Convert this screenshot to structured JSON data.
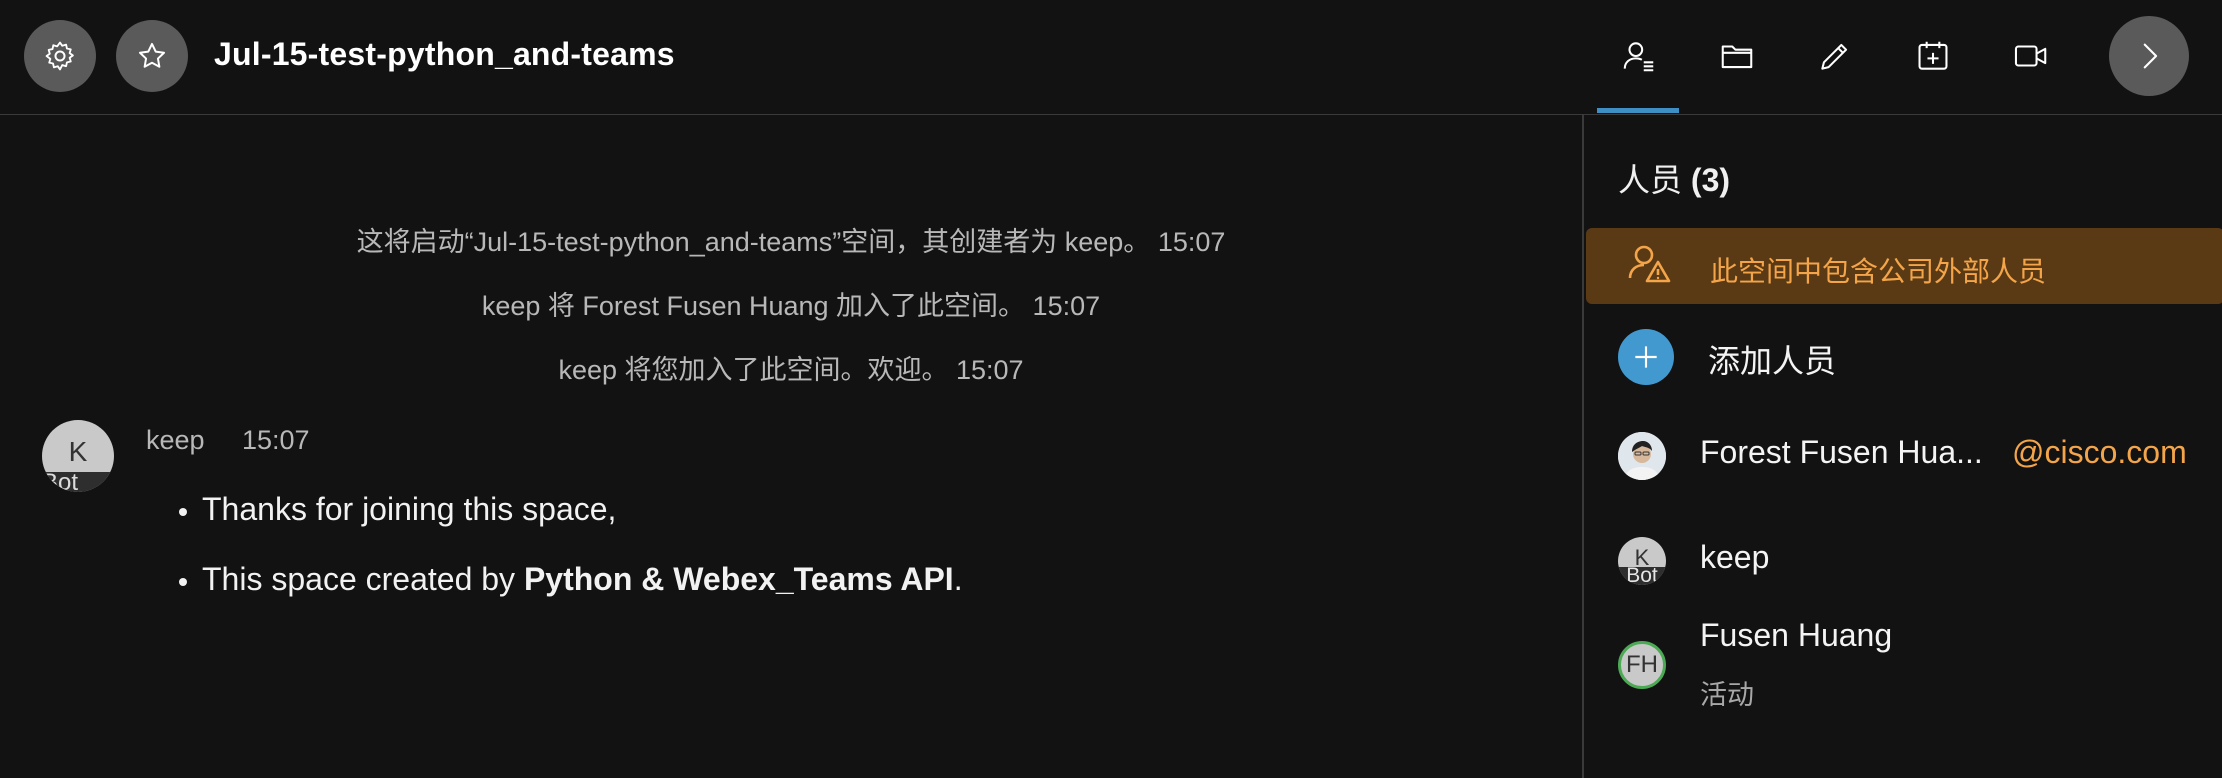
{
  "header": {
    "title": "Jul-15-test-python_and-teams",
    "settings_icon": "gear-icon",
    "favorite_icon": "star-icon",
    "tools": [
      "people-icon",
      "folder-icon",
      "pencil-icon",
      "calendar-add-icon",
      "video-icon"
    ],
    "next_icon": "chevron-right-icon"
  },
  "chat": {
    "system_messages": [
      "这将启动“Jul-15-test-python_and-teams”空间，其创建者为 keep。 15:07",
      "keep 将 Forest Fusen Huang 加入了此空间。 15:07",
      "keep 将您加入了此空间。欢迎。 15:07"
    ],
    "message": {
      "avatar_letter": "K",
      "avatar_badge": "Bot",
      "sender": "keep",
      "time": "15:07",
      "bullet_1": "Thanks for joining this space,",
      "bullet_2_prefix": "This space created by ",
      "bullet_2_bold": "Python & Webex_Teams API",
      "bullet_2_suffix": "."
    }
  },
  "panel": {
    "title_prefix": "人员 ",
    "title_count": "(3)",
    "warning_text": "此空间中包含公司外部人员",
    "warning_color": "#f4a54a",
    "add_label": "添加人员",
    "people": [
      {
        "name": "Forest Fusen Hua...",
        "domain": "@cisco.com",
        "avatar": "photo"
      },
      {
        "name": "keep",
        "avatar_letter": "K",
        "avatar_badge": "Bot"
      },
      {
        "name": "Fusen Huang",
        "status": "活动",
        "avatar_initials": "FH"
      }
    ]
  },
  "colors": {
    "background": "#121212",
    "accent_blue": "#4199d0",
    "warning_bg": "#5a3a14",
    "active_tab": "#3d8fc4",
    "presence_green": "#4caa55"
  }
}
